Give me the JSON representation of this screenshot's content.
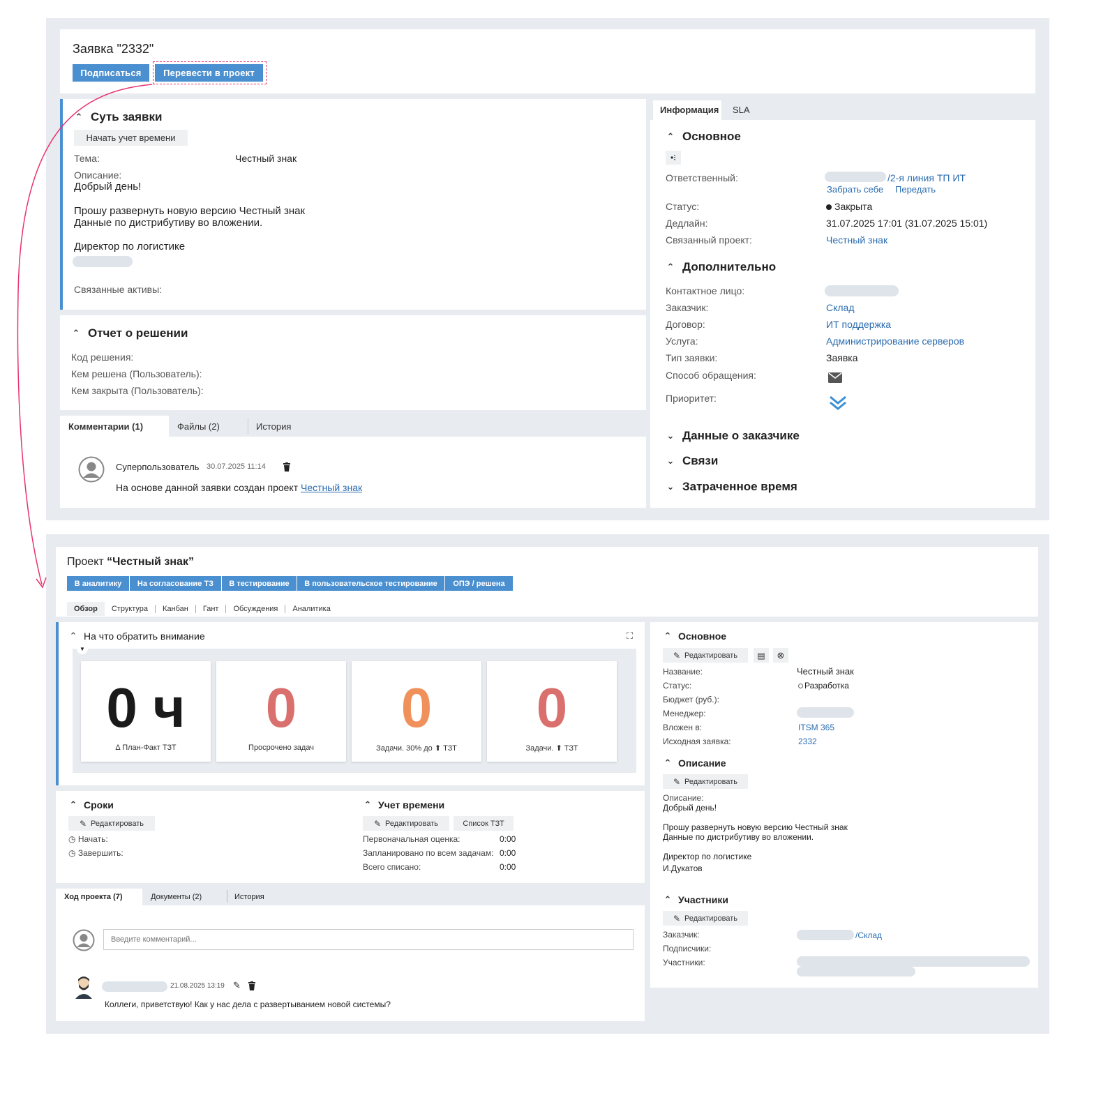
{
  "ticket": {
    "title": "Заявка \"2332\"",
    "subscribe_btn": "Подписаться",
    "convert_btn": "Перевести в проект",
    "essence": {
      "title": "Суть заявки",
      "start_time_btn": "Начать учет времени",
      "topic_label": "Тема:",
      "topic_value": "Честный знак",
      "desc_label": "Описание:",
      "desc_line1": "Добрый день!",
      "desc_line2": "Прошу развернуть новую версию Честный знак",
      "desc_line3": "Данные по дистрибутиву во вложении.",
      "desc_line4": "Директор по логистике",
      "assets_label": "Связанные активы:"
    },
    "report": {
      "title": "Отчет о решении",
      "code_label": "Код решения:",
      "solved_by_label": "Кем решена (Пользователь):",
      "closed_by_label": "Кем закрыта (Пользователь):"
    },
    "tabs": [
      "Комментарии (1)",
      "Файлы (2)",
      "История"
    ],
    "comment": {
      "author": "Суперпользователь",
      "date": "30.07.2025 11:14",
      "text": "На основе данной заявки создан проект ",
      "link": "Честный знак"
    },
    "side_tabs": [
      "Информация",
      "SLA"
    ],
    "main": {
      "title": "Основное",
      "responsible_label": "Ответственный:",
      "responsible_value": "/2-я линия ТП ИТ",
      "take_link": "Забрать себе",
      "pass_link": "Передать",
      "status_label": "Статус:",
      "status_value": "Закрыта",
      "deadline_label": "Дедлайн:",
      "deadline_value": "31.07.2025 17:01 (31.07.2025 15:01)",
      "project_label": "Связанный проект:",
      "project_value": "Честный знак"
    },
    "extra": {
      "title": "Дополнительно",
      "contact_label": "Контактное лицо:",
      "customer_label": "Заказчик:",
      "customer_value": "Склад",
      "contract_label": "Договор:",
      "contract_value": "ИТ поддержка",
      "service_label": "Услуга:",
      "service_value": "Администрирование серверов",
      "type_label": "Тип заявки:",
      "type_value": "Заявка",
      "method_label": "Способ обращения:",
      "priority_label": "Приоритет:"
    },
    "collapsed": [
      "Данные о заказчике",
      "Связи",
      "Затраченное время"
    ]
  },
  "project": {
    "title_prefix": "Проект ",
    "title_name": "“Честный знак”",
    "stage_buttons": [
      "В аналитику",
      "На согласование ТЗ",
      "В тестирование",
      "В пользовательское тестирование",
      "ОПЭ / решена"
    ],
    "tabs": [
      "Обзор",
      "Структура",
      "Канбан",
      "Гант",
      "Обсуждения",
      "Аналитика"
    ],
    "attention": {
      "title": "На что обратить внимание",
      "kpis": [
        {
          "value": "0 ч",
          "caption": "Δ План-Факт ТЗТ",
          "color": "#1a1a1a"
        },
        {
          "value": "0",
          "caption": "Просрочено задач",
          "color": "#d9706e"
        },
        {
          "value": "0",
          "caption": "Задачи. 30% до ⬆ ТЗТ",
          "color": "#f0915c"
        },
        {
          "value": "0",
          "caption": "Задачи. ⬆ ТЗТ",
          "color": "#d9706e"
        }
      ]
    },
    "terms": {
      "title": "Сроки",
      "edit_btn": "Редактировать",
      "start_label": "Начать:",
      "finish_label": "Завершить:"
    },
    "time": {
      "title": "Учет времени",
      "edit_btn": "Редактировать",
      "list_btn": "Список ТЗТ",
      "initial_label": "Первоначальная оценка:",
      "initial_value": "0:00",
      "planned_label": "Запланировано по всем задачам:",
      "planned_value": "0:00",
      "total_label": "Всего списано:",
      "total_value": "0:00"
    },
    "bottom_tabs": [
      "Ход проекта (7)",
      "Документы (2)",
      "История"
    ],
    "comment_placeholder": "Введите комментарий...",
    "comment": {
      "date": "21.08.2025 13:19",
      "text": "Коллеги, приветствую! Как у нас дела с развертыванием новой системы?"
    },
    "main": {
      "title": "Основное",
      "edit_btn": "Редактировать",
      "name_label": "Название:",
      "name_value": "Честный знак",
      "status_label": "Статус:",
      "status_value": "Разработка",
      "budget_label": "Бюджет (руб.):",
      "manager_label": "Менеджер:",
      "nested_label": "Вложен в:",
      "nested_value": "ITSM 365",
      "source_label": "Исходная заявка:",
      "source_value": "2332"
    },
    "description": {
      "title": "Описание",
      "edit_btn": "Редактировать",
      "label": "Описание:",
      "line1": "Добрый день!",
      "line2": "Прошу развернуть новую версию Честный знак",
      "line3": "Данные по дистрибутиву во вложении.",
      "line4": "Директор по логистике",
      "line5": "И.Дукатов"
    },
    "members": {
      "title": "Участники",
      "edit_btn": "Редактировать",
      "customer_label": "Заказчик:",
      "customer_value": "/Склад",
      "subscribers_label": "Подписчики:",
      "members_label": "Участники:"
    }
  },
  "colors": {
    "accent": "#4a8fd0",
    "link": "#2b6cb0",
    "arrow": "#e8336f"
  }
}
